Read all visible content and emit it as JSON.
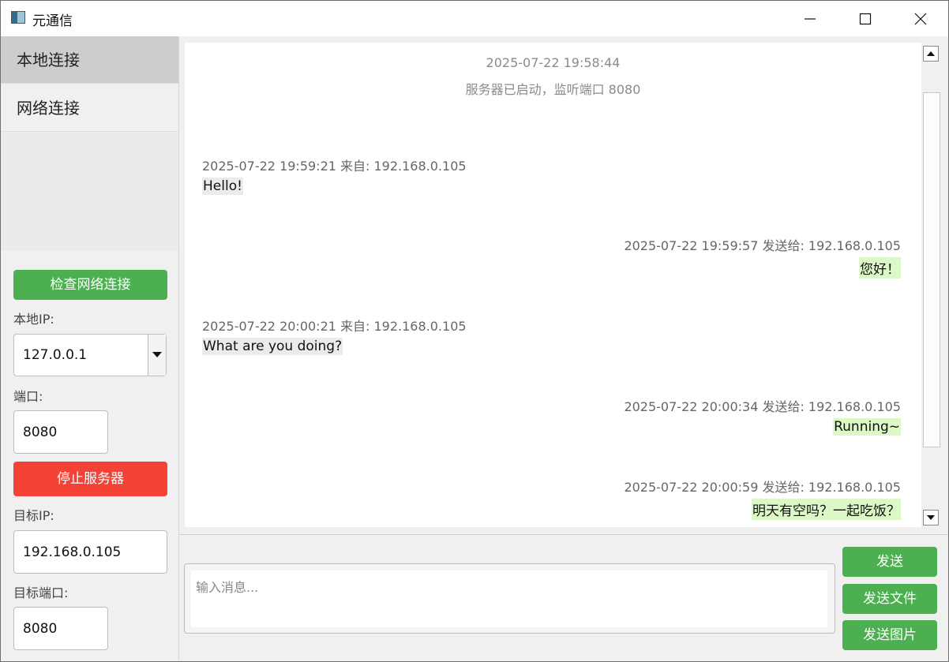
{
  "window": {
    "title": "元通信",
    "icon": "app-window-icon"
  },
  "sidebar": {
    "nav": [
      {
        "label": "本地连接",
        "active": true
      },
      {
        "label": "网络连接",
        "active": false
      }
    ],
    "check_button": "检查网络连接",
    "local_ip_label": "本地IP:",
    "local_ip_value": "127.0.0.1",
    "port_label": "端口:",
    "port_value": "8080",
    "stop_button": "停止服务器",
    "target_ip_label": "目标IP:",
    "target_ip_value": "192.168.0.105",
    "target_port_label": "目标端口:",
    "target_port_value": "8080"
  },
  "chat": {
    "system": {
      "time": "2025-07-22 19:58:44",
      "text": "服务器已启动，监听端口 8080"
    },
    "messages": [
      {
        "direction": "in",
        "meta": "2025-07-22 19:59:21 来自: 192.168.0.105",
        "text": "Hello!"
      },
      {
        "direction": "out",
        "meta": "2025-07-22 19:59:57 发送给: 192.168.0.105",
        "text": "您好！"
      },
      {
        "direction": "in",
        "meta": "2025-07-22 20:00:21 来自: 192.168.0.105",
        "text": "What are you doing?"
      },
      {
        "direction": "out",
        "meta": "2025-07-22 20:00:34 发送给: 192.168.0.105",
        "text": "Running~"
      },
      {
        "direction": "out",
        "meta": "2025-07-22 20:00:59 发送给: 192.168.0.105",
        "text": "明天有空吗？一起吃饭？"
      }
    ]
  },
  "composer": {
    "placeholder": "输入消息...",
    "send": "发送",
    "send_file": "发送文件",
    "send_image": "发送图片"
  },
  "colors": {
    "green": "#4caf50",
    "red": "#f44336",
    "out_bubble": "#dcf8c6",
    "in_bubble": "#ebebeb"
  }
}
